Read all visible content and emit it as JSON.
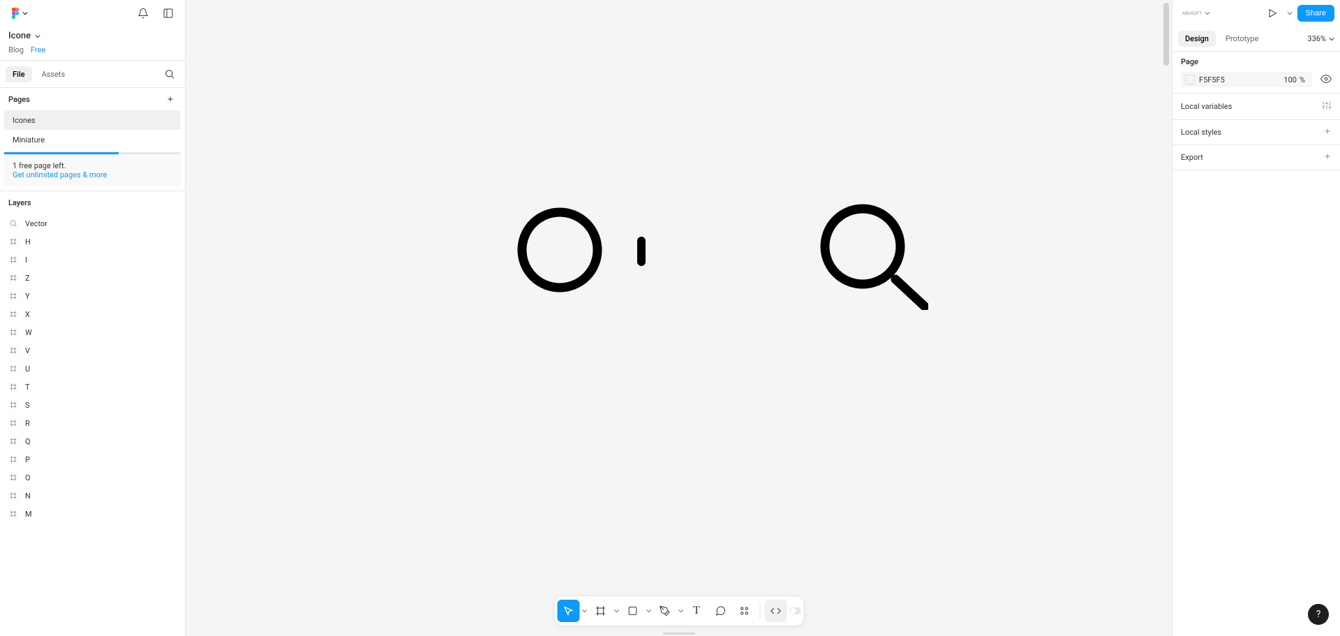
{
  "file": {
    "title": "Icone",
    "project": "Blog",
    "plan": "Free"
  },
  "leftTabs": {
    "file": "File",
    "assets": "Assets"
  },
  "pages": {
    "header": "Pages",
    "items": [
      "Icones",
      "Miniature"
    ],
    "activeIndex": 0
  },
  "quota": {
    "line1": "1 free page left.",
    "link": "Get unlimited pages & more"
  },
  "layers": {
    "header": "Layers",
    "items": [
      {
        "name": "Vector",
        "type": "vector"
      },
      {
        "name": "H",
        "type": "frame"
      },
      {
        "name": "I",
        "type": "frame"
      },
      {
        "name": "Z",
        "type": "frame"
      },
      {
        "name": "Y",
        "type": "frame"
      },
      {
        "name": "X",
        "type": "frame"
      },
      {
        "name": "W",
        "type": "frame"
      },
      {
        "name": "V",
        "type": "frame"
      },
      {
        "name": "U",
        "type": "frame"
      },
      {
        "name": "T",
        "type": "frame"
      },
      {
        "name": "S",
        "type": "frame"
      },
      {
        "name": "R",
        "type": "frame"
      },
      {
        "name": "Q",
        "type": "frame"
      },
      {
        "name": "P",
        "type": "frame"
      },
      {
        "name": "O",
        "type": "frame"
      },
      {
        "name": "N",
        "type": "frame"
      },
      {
        "name": "M",
        "type": "frame"
      }
    ]
  },
  "rightTop": {
    "userLabel": "ABUSOFT",
    "share": "Share"
  },
  "designTabs": {
    "design": "Design",
    "prototype": "Prototype",
    "zoom": "336%"
  },
  "pagePanel": {
    "title": "Page",
    "color": "F5F5F5",
    "opacity": "100",
    "opacityUnit": "%"
  },
  "panels": {
    "localVariables": "Local variables",
    "localStyles": "Local styles",
    "export": "Export"
  },
  "colors": {
    "accent": "#0d99ff",
    "canvasBg": "#f5f5f5"
  }
}
